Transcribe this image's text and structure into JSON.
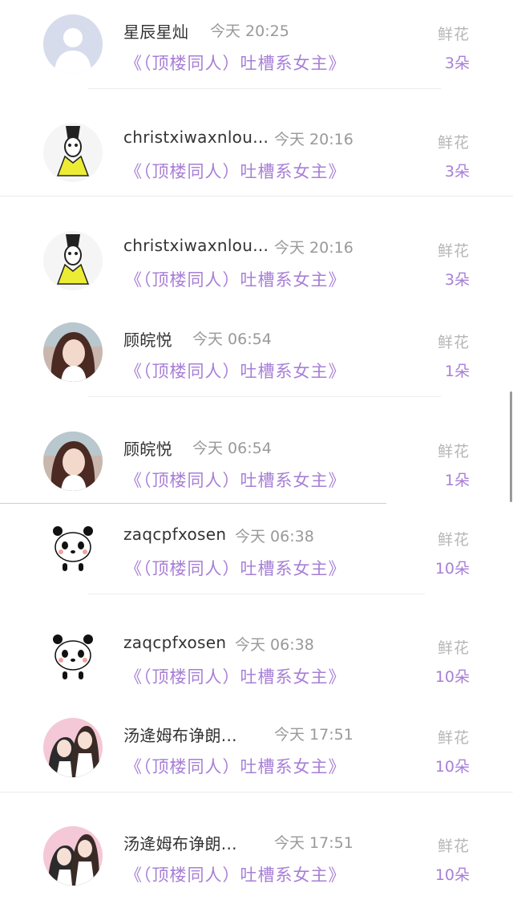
{
  "rows": [
    {
      "name": "星辰星灿",
      "time": "今天 20:25",
      "book": "《（顶楼同人）吐槽系女主》",
      "gift": "鲜花",
      "count": "3朵",
      "avatar": "default-avatar-icon"
    },
    {
      "name": "christxiwaxnlou...",
      "time": "今天 20:16",
      "book": "《（顶楼同人）吐槽系女主》",
      "gift": "鲜花",
      "count": "3朵",
      "avatar": "cartoon-character-avatar"
    },
    {
      "name": "christxiwaxnlou...",
      "time": "今天 20:16",
      "book": "《（顶楼同人）吐槽系女主》",
      "gift": "鲜花",
      "count": "3朵",
      "avatar": "cartoon-character-avatar"
    },
    {
      "name": "顾皖悦",
      "time": "今天 06:54",
      "book": "《（顶楼同人）吐槽系女主》",
      "gift": "鲜花",
      "count": "1朵",
      "avatar": "girl-photo-avatar"
    },
    {
      "name": "顾皖悦",
      "time": "今天 06:54",
      "book": "《（顶楼同人）吐槽系女主》",
      "gift": "鲜花",
      "count": "1朵",
      "avatar": "girl-photo-avatar"
    },
    {
      "name": "zaqcpfxosen",
      "time": "今天 06:38",
      "book": "《（顶楼同人）吐槽系女主》",
      "gift": "鲜花",
      "count": "10朵",
      "avatar": "panda-avatar"
    },
    {
      "name": "zaqcpfxosen",
      "time": "今天 06:38",
      "book": "《（顶楼同人）吐槽系女主》",
      "gift": "鲜花",
      "count": "10朵",
      "avatar": "panda-avatar"
    },
    {
      "name": "汤逄姆布诤朗...",
      "time": "今天 17:51",
      "book": "《（顶楼同人）吐槽系女主》",
      "gift": "鲜花",
      "count": "10朵",
      "avatar": "couple-photo-avatar"
    },
    {
      "name": "汤逄姆布诤朗...",
      "time": "今天 17:51",
      "book": "《（顶楼同人）吐槽系女主》",
      "gift": "鲜花",
      "count": "10朵",
      "avatar": "couple-photo-avatar"
    }
  ],
  "colors": {
    "accent": "#a77fd6",
    "name": "#333333",
    "muted": "#999999"
  }
}
